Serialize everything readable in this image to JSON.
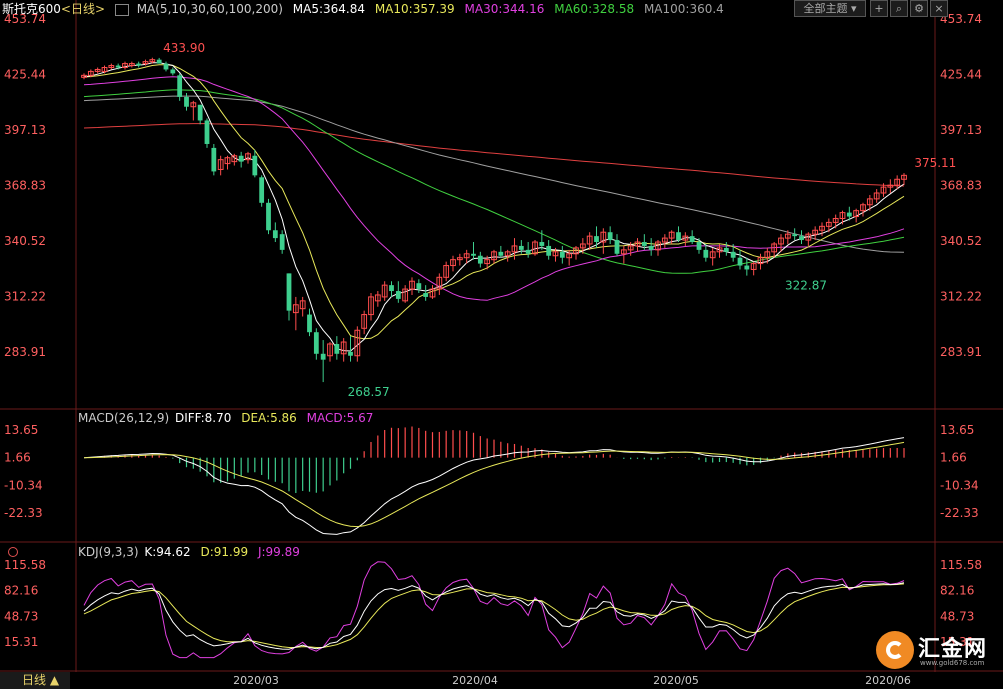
{
  "header": {
    "symbol": "斯托克600",
    "period": "<日线>",
    "ma_label": "MA(5,10,30,60,100,200)",
    "ma5": "MA5:364.84",
    "ma10": "MA10:357.39",
    "ma30": "MA30:344.16",
    "ma60": "MA60:328.58",
    "ma100": "MA100:360.4",
    "theme_button": "全部主题"
  },
  "macd_header": {
    "label": "MACD(26,12,9)",
    "diff": "DIFF:8.70",
    "dea": "DEA:5.86",
    "macd": "MACD:5.67"
  },
  "kdj_header": {
    "label": "KDJ(9,3,3)",
    "k": "K:94.62",
    "d": "D:91.99",
    "j": "J:99.89"
  },
  "footer": {
    "period_tab": "日线",
    "x_labels": [
      "2020/03",
      "2020/04",
      "2020/05",
      "2020/06"
    ]
  },
  "logo": {
    "name": "汇金网",
    "url": "www.gold678.com"
  },
  "colors": {
    "up": "#ff4d4d",
    "down": "#3ecf8e",
    "ma5": "#ffffff",
    "ma10": "#e8e85a",
    "ma30": "#e040e0",
    "ma60": "#40d040",
    "ma100": "#a0a0a0",
    "ma200": "#e04040"
  },
  "chart_data": [
    {
      "type": "candlestick",
      "name": "price",
      "y_ticks": [
        "453.74",
        "425.44",
        "397.13",
        "368.83",
        "340.52",
        "312.22",
        "283.91"
      ],
      "annotations": [
        {
          "text": "433.90",
          "value": 433.9,
          "index": 11
        },
        {
          "text": "268.57",
          "value": 268.57,
          "index": 38
        },
        {
          "text": "322.87",
          "value": 322.87,
          "index": 102
        },
        {
          "text": "375.11",
          "value": 375.11,
          "index": 124
        }
      ],
      "ohlc": [
        [
          424,
          426,
          423,
          425
        ],
        [
          425,
          428,
          424,
          427
        ],
        [
          427,
          429,
          426,
          428
        ],
        [
          427,
          430,
          426,
          429
        ],
        [
          429,
          431,
          428,
          430
        ],
        [
          430,
          431,
          428,
          429
        ],
        [
          429,
          432,
          428,
          431
        ],
        [
          430,
          432,
          429,
          431
        ],
        [
          431,
          432,
          429,
          430
        ],
        [
          431,
          433,
          430,
          432
        ],
        [
          432,
          434,
          431,
          433
        ],
        [
          433,
          433.9,
          431,
          431
        ],
        [
          431,
          432,
          427,
          428
        ],
        [
          428,
          429,
          425,
          426
        ],
        [
          425,
          426,
          412,
          414
        ],
        [
          414,
          416,
          407,
          409
        ],
        [
          409,
          412,
          402,
          411
        ],
        [
          410,
          410,
          400,
          402
        ],
        [
          402,
          403,
          388,
          390
        ],
        [
          388,
          390,
          374,
          376
        ],
        [
          377,
          384,
          374,
          382
        ],
        [
          380,
          384,
          377,
          383
        ],
        [
          381,
          385,
          379,
          384
        ],
        [
          384,
          386,
          378,
          381
        ],
        [
          382,
          386,
          380,
          385
        ],
        [
          384,
          387,
          373,
          374
        ],
        [
          373,
          374,
          358,
          360
        ],
        [
          360,
          362,
          344,
          346
        ],
        [
          346,
          350,
          340,
          342
        ],
        [
          344,
          346,
          334,
          336
        ],
        [
          324,
          324,
          300,
          305
        ],
        [
          304,
          312,
          295,
          308
        ],
        [
          306,
          312,
          302,
          310
        ],
        [
          303,
          306,
          292,
          294
        ],
        [
          294,
          296,
          280,
          283
        ],
        [
          283,
          290,
          268.57,
          280
        ],
        [
          282,
          289,
          279,
          288
        ],
        [
          288,
          292,
          280,
          283
        ],
        [
          283,
          291,
          279,
          289
        ],
        [
          284,
          292,
          279,
          282
        ],
        [
          282,
          297,
          279,
          295
        ],
        [
          296,
          305,
          293,
          303
        ],
        [
          303,
          314,
          300,
          312
        ],
        [
          310,
          315,
          307,
          313
        ],
        [
          312,
          320,
          310,
          318
        ],
        [
          318,
          320,
          312,
          315
        ],
        [
          315,
          320,
          309,
          311
        ],
        [
          310,
          318,
          309,
          316
        ],
        [
          316,
          322,
          313,
          320
        ],
        [
          319,
          321,
          314,
          316
        ],
        [
          314,
          318,
          310,
          312
        ],
        [
          312,
          318,
          311,
          316
        ],
        [
          316,
          324,
          313,
          322
        ],
        [
          322,
          330,
          320,
          328
        ],
        [
          328,
          333,
          325,
          331
        ],
        [
          331,
          334,
          328,
          332
        ],
        [
          332,
          336,
          329,
          334
        ],
        [
          334,
          340,
          331,
          333
        ],
        [
          333,
          335,
          327,
          329
        ],
        [
          329,
          333,
          326,
          331
        ],
        [
          331,
          336,
          329,
          335
        ],
        [
          335,
          338,
          332,
          333
        ],
        [
          333,
          336,
          330,
          335
        ],
        [
          335,
          342,
          331,
          338
        ],
        [
          338,
          341,
          334,
          336
        ],
        [
          336,
          340,
          332,
          334
        ],
        [
          334,
          341,
          333,
          340
        ],
        [
          340,
          346,
          336,
          338
        ],
        [
          338,
          341,
          331,
          333
        ],
        [
          333,
          337,
          330,
          335
        ],
        [
          335,
          338,
          329,
          332
        ],
        [
          332,
          336,
          328,
          334
        ],
        [
          334,
          338,
          331,
          337
        ],
        [
          337,
          342,
          334,
          339
        ],
        [
          339,
          345,
          336,
          343
        ],
        [
          343,
          348,
          337,
          340
        ],
        [
          340,
          347,
          334,
          345
        ],
        [
          345,
          348,
          339,
          341
        ],
        [
          341,
          344,
          333,
          334
        ],
        [
          334,
          338,
          329,
          336
        ],
        [
          336,
          340,
          333,
          338
        ],
        [
          338,
          342,
          335,
          340
        ],
        [
          340,
          344,
          336,
          338
        ],
        [
          338,
          342,
          333,
          336
        ],
        [
          336,
          341,
          333,
          340
        ],
        [
          340,
          344,
          337,
          342
        ],
        [
          342,
          346,
          339,
          345
        ],
        [
          345,
          348,
          340,
          341
        ],
        [
          341,
          345,
          338,
          343
        ],
        [
          343,
          346,
          339,
          340
        ],
        [
          340,
          342,
          334,
          336
        ],
        [
          336,
          339,
          330,
          332
        ],
        [
          332,
          337,
          328,
          335
        ],
        [
          335,
          339,
          332,
          337
        ],
        [
          337,
          340,
          333,
          335
        ],
        [
          335,
          339,
          330,
          332
        ],
        [
          332,
          336,
          326,
          328
        ],
        [
          328,
          332,
          322.87,
          326
        ],
        [
          326,
          330,
          323,
          329
        ],
        [
          329,
          334,
          326,
          332
        ],
        [
          332,
          337,
          329,
          335
        ],
        [
          335,
          340,
          332,
          339
        ],
        [
          339,
          344,
          335,
          342
        ],
        [
          342,
          346,
          339,
          344
        ],
        [
          344,
          347,
          341,
          343
        ],
        [
          343,
          346,
          339,
          341
        ],
        [
          341,
          345,
          338,
          344
        ],
        [
          344,
          348,
          341,
          346
        ],
        [
          346,
          350,
          343,
          348
        ],
        [
          348,
          352,
          345,
          350
        ],
        [
          350,
          354,
          347,
          352
        ],
        [
          352,
          356,
          349,
          355
        ],
        [
          355,
          358,
          351,
          353
        ],
        [
          353,
          357,
          350,
          356
        ],
        [
          356,
          360,
          353,
          359
        ],
        [
          359,
          364,
          356,
          362
        ],
        [
          362,
          367,
          360,
          365
        ],
        [
          365,
          370,
          363,
          368
        ],
        [
          368,
          372,
          365,
          369
        ],
        [
          369,
          374,
          367,
          372
        ],
        [
          372,
          375.11,
          369,
          374
        ]
      ]
    },
    {
      "type": "bar+line",
      "name": "MACD",
      "y_ticks": [
        "13.65",
        "1.66",
        "-10.34",
        "-22.33"
      ]
    },
    {
      "type": "line",
      "name": "KDJ",
      "y_ticks": [
        "115.58",
        "82.16",
        "48.73",
        "15.31"
      ]
    }
  ]
}
